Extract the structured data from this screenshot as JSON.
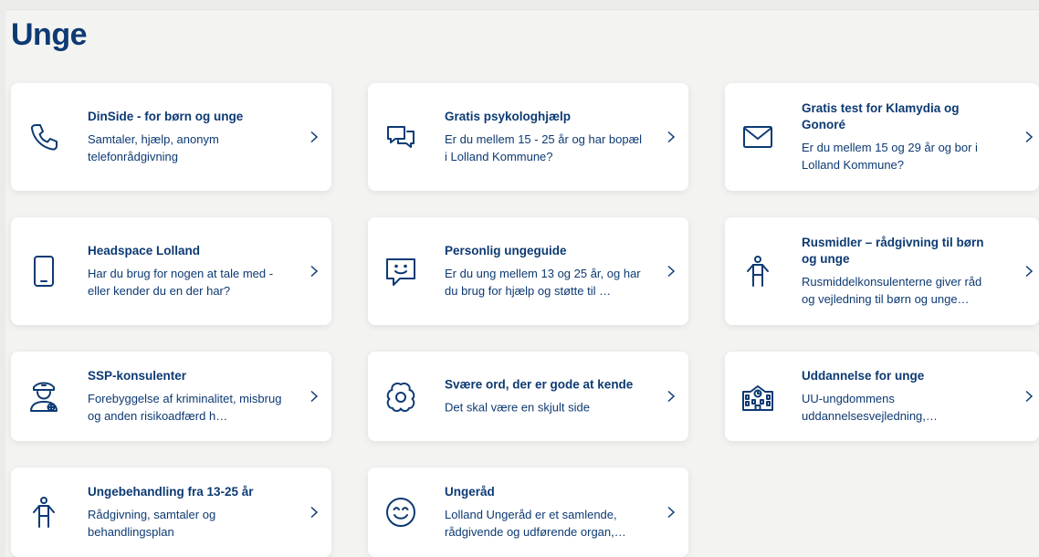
{
  "page": {
    "title": "Unge"
  },
  "colors": {
    "accent": "#0d3a73",
    "card_bg": "#ffffff",
    "page_bg": "#f3f3f1"
  },
  "cards": [
    {
      "title": "DinSide - for børn og unge",
      "description": "Samtaler, hjælp, anonym telefonrådgivning",
      "icon": "phone-icon"
    },
    {
      "title": "Gratis psykologhjælp",
      "description": "Er du mellem 15 - 25 år og har bopæl i Lolland Kommune?",
      "icon": "chat-bubbles-icon"
    },
    {
      "title": "Gratis test for Klamydia og Gonoré",
      "description": "Er du mellem 15 og 29 år og bor i Lolland Kommune?",
      "icon": "envelope-icon"
    },
    {
      "title": "Headspace Lolland",
      "description": "Har du brug for nogen at tale med - eller kender du en der har?",
      "icon": "mobile-phone-icon"
    },
    {
      "title": "Personlig ungeguide",
      "description": "Er du ung mellem 13 og 25 år, og har du brug for hjælp og støtte til …",
      "icon": "smiley-chat-icon"
    },
    {
      "title": "Rusmidler – rådgivning til børn og unge",
      "description": "Rusmiddelkonsulenterne giver råd og vejledning til børn og unge…",
      "icon": "person-icon"
    },
    {
      "title": "SSP-konsulenter",
      "description": "Forebyggelse af kriminalitet, misbrug og anden risikoadfærd h…",
      "icon": "police-officer-icon"
    },
    {
      "title": "Svære ord, der er gode at kende",
      "description": "Det skal være en skjult side",
      "icon": "flower-icon"
    },
    {
      "title": "Uddannelse for unge",
      "description": "UU-ungdommens uddannelsesvejledning,…",
      "icon": "school-building-icon"
    },
    {
      "title": "Ungebehandling fra 13-25 år",
      "description": "Rådgivning, samtaler og behandlingsplan",
      "icon": "person-icon"
    },
    {
      "title": "Ungeråd",
      "description": "Lolland Ungeråd er et samlende, rådgivende og udførende organ,…",
      "icon": "smiley-face-icon"
    }
  ]
}
